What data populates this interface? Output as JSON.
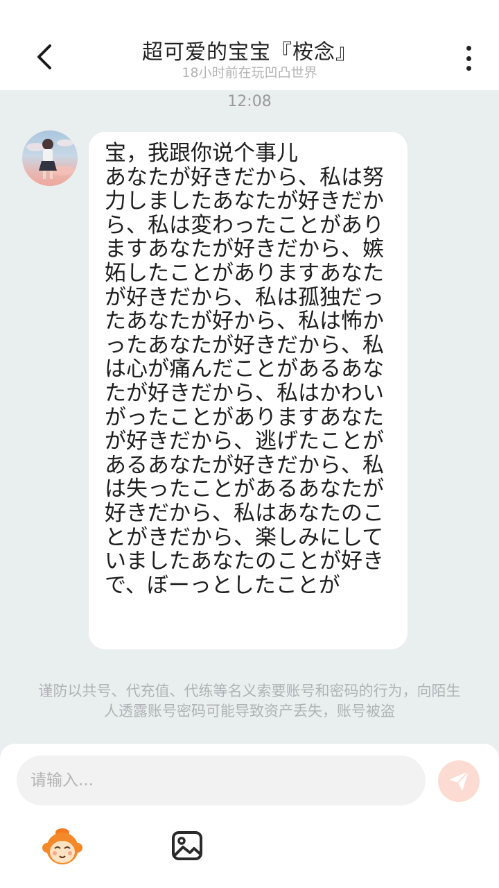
{
  "header": {
    "title": "超可爱的宝宝『桉念』",
    "subtitle": "18小时前在玩凹凸世界",
    "back_icon": "chevron-left-icon",
    "more_icon": "vertical-ellipsis-icon"
  },
  "chat": {
    "timestamp": "12:08",
    "messages": [
      {
        "sender": "other",
        "avatar": "girl-pink-sky-avatar",
        "text": "宝，我跟你说个事儿\nあなたが好きだから、私は努力しましたあなたが好きだから、私は変わったことがありますあなたが好きだから、嫉妬したことがありますあなたが好きだから、私は孤独だったあなたが好から、私は怖かったあなたが好きだから、私は心が痛んだことがあるあなたが好きだから、私はかわいがったことがありますあなたが好きだから、逃げたことがあるあなたが好きだから、私は失ったことがあるあなたが好きだから、私はあなたのことがきだから、楽しみにしていましたあなたのことが好きで、ぼーっとしたことが"
      }
    ]
  },
  "notice": "谨防以共号、代充值、代练等名义索要账号和密码的行为，向陌生人透露账号密码可能导致资产丢失，账号被盗",
  "composer": {
    "placeholder": "请输入...",
    "send_icon": "paper-plane-icon",
    "emoji_icon": "monkey-face-icon",
    "image_icon": "image-icon",
    "send_color": "#fcdcd2",
    "send_icon_color": "#ffffff"
  },
  "colors": {
    "background": "#e9eeef",
    "header": "#ffffff",
    "bubble": "#ffffff"
  }
}
